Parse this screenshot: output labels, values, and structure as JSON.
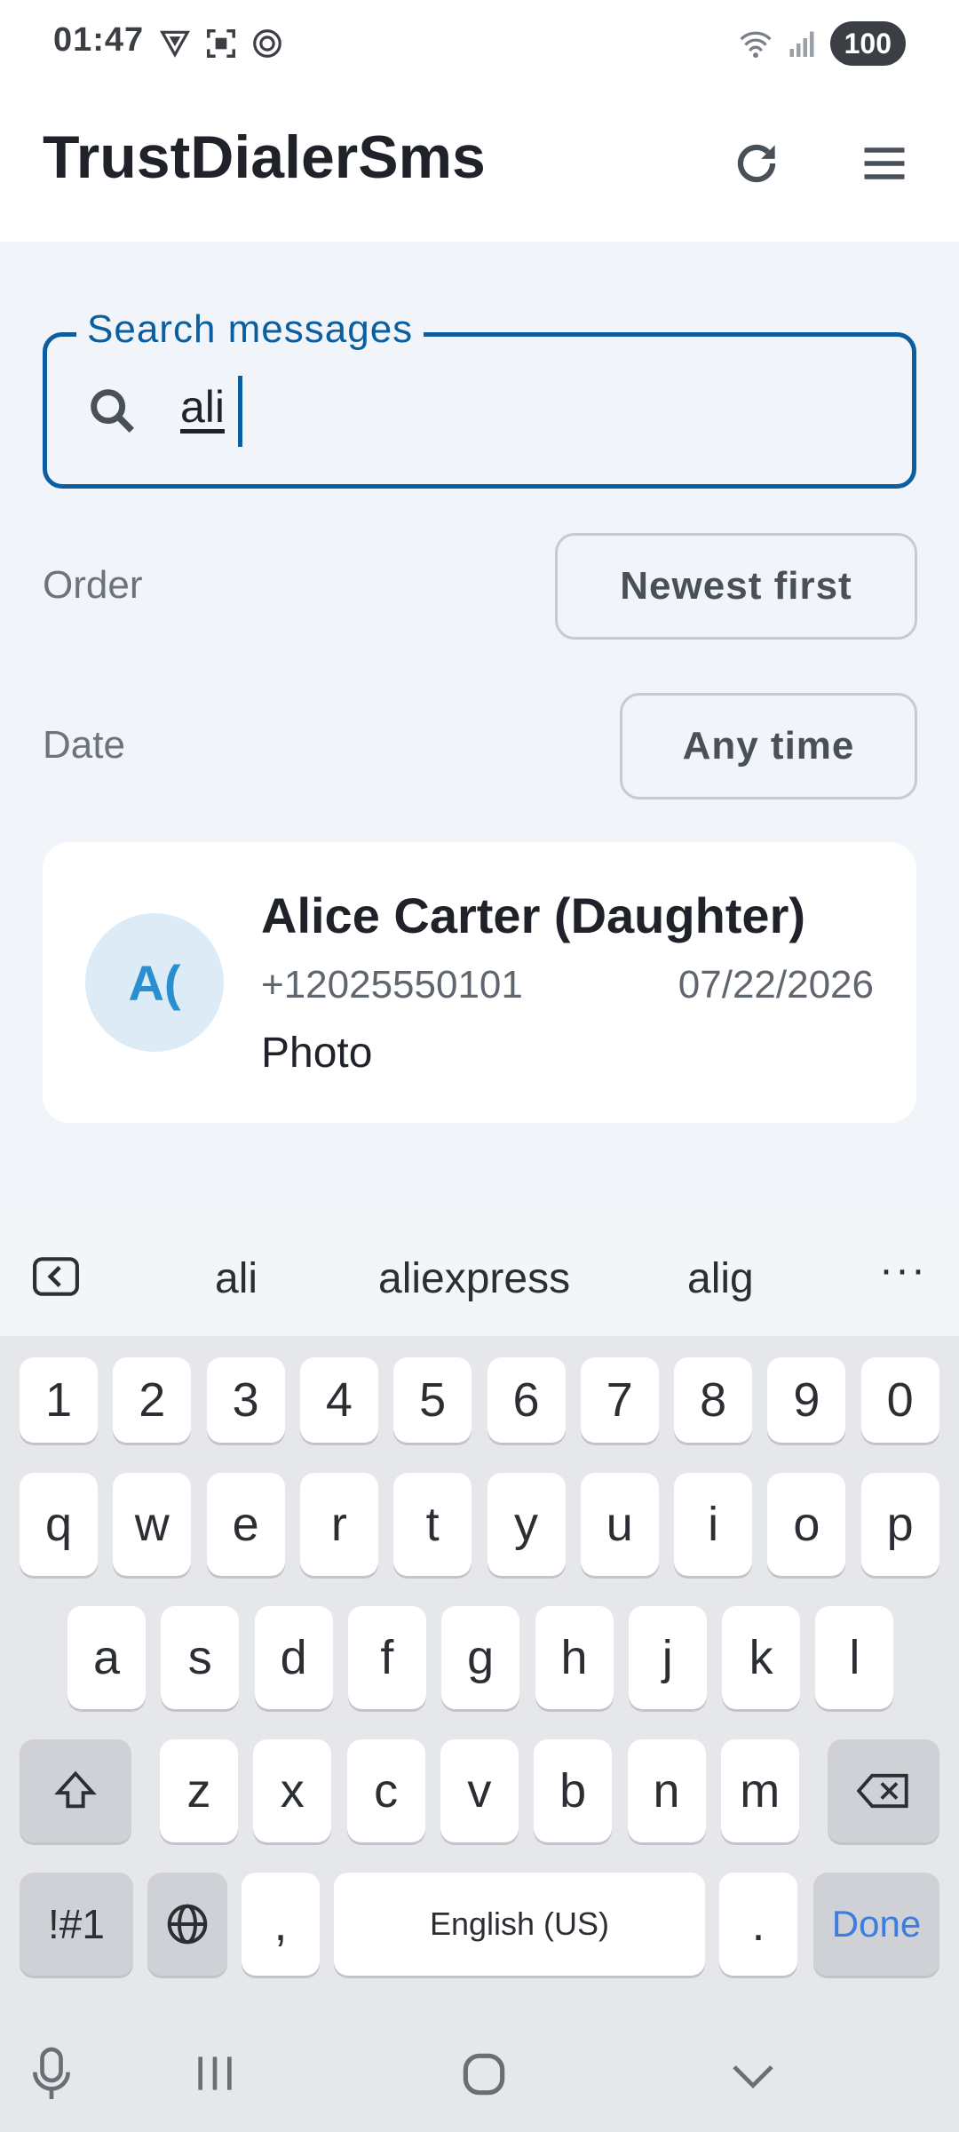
{
  "status_bar": {
    "time": "01:47",
    "battery": "100",
    "left_icons": [
      "vpn-shield-icon",
      "screenshot-icon",
      "openai-icon"
    ],
    "right_icons": [
      "wifi-icon",
      "signal-icon"
    ]
  },
  "app_bar": {
    "title": "TrustDialerSms",
    "actions": [
      "refresh-icon",
      "hamburger-menu-icon"
    ]
  },
  "search": {
    "label": "Search messages",
    "value": "ali",
    "accent_color": "#0b5fa0"
  },
  "filters": {
    "order_label": "Order",
    "order_value": "Newest first",
    "date_label": "Date",
    "date_value": "Any time"
  },
  "results": [
    {
      "avatar_text": "A(",
      "name": "Alice Carter (Daughter)",
      "phone": "+12025550101",
      "date": "07/22/2026",
      "preview": "Photo"
    }
  ],
  "keyboard": {
    "suggestions": [
      "ali",
      "aliexpress",
      "alig"
    ],
    "more_label": "···",
    "row_numbers": [
      "1",
      "2",
      "3",
      "4",
      "5",
      "6",
      "7",
      "8",
      "9",
      "0"
    ],
    "row1": [
      "q",
      "w",
      "e",
      "r",
      "t",
      "y",
      "u",
      "i",
      "o",
      "p"
    ],
    "row2": [
      "a",
      "s",
      "d",
      "f",
      "g",
      "h",
      "j",
      "k",
      "l"
    ],
    "row3": [
      "z",
      "x",
      "c",
      "v",
      "b",
      "n",
      "m"
    ],
    "symbols_label": "!#1",
    "comma_label": ",",
    "space_label": "English (US)",
    "period_label": ".",
    "done_label": "Done"
  }
}
